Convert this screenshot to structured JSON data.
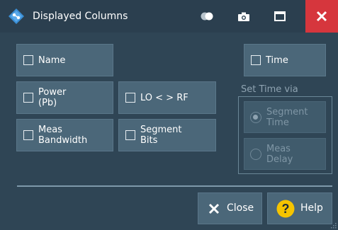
{
  "window": {
    "title": "Displayed Columns"
  },
  "titlebar": {
    "toggle_icon": "toggle-icon",
    "camera_icon": "camera-icon",
    "maximize_icon": "maximize-icon",
    "close_icon": "close-icon",
    "close_color": "#d6363d"
  },
  "columns": {
    "name": {
      "label": "Name",
      "checked": false
    },
    "power": {
      "label": "Power\n(Pb)",
      "checked": false
    },
    "lo_rf": {
      "label": "LO < > RF",
      "checked": false
    },
    "meas_bandwidth": {
      "label": "Meas\nBandwidth",
      "checked": false
    },
    "segment_bits": {
      "label": "Segment\nBits",
      "checked": false
    },
    "time": {
      "label": "Time",
      "checked": false
    }
  },
  "set_time": {
    "group_label": "Set Time via",
    "options": [
      {
        "label": "Segment\nTime",
        "selected": true,
        "enabled": false
      },
      {
        "label": "Meas\nDelay",
        "selected": false,
        "enabled": false
      }
    ]
  },
  "footer": {
    "close_label": "Close",
    "help_label": "Help",
    "help_icon_color": "#f5c400"
  },
  "colors": {
    "background": "#2f4555",
    "button": "#4b6779",
    "separator": "#7e99aa"
  }
}
